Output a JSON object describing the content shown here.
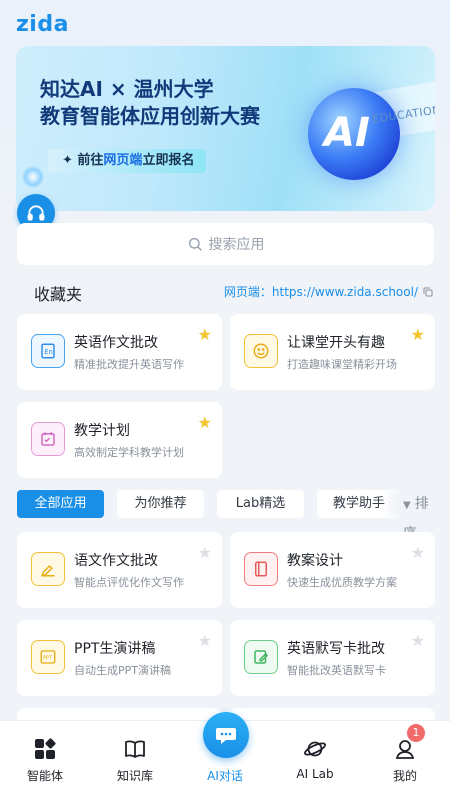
{
  "brand": {
    "logo": "zida",
    "accent": "#1a8fe8"
  },
  "banner": {
    "title_line1": "知达AI × 温州大学",
    "title_line2": "教育智能体应用创新大赛",
    "cta_prefix": "✦ 前往",
    "cta_highlight": "网页端",
    "cta_suffix": "立即报名",
    "orb_text": "AI",
    "side_text": "EDUCATION"
  },
  "search": {
    "placeholder": "搜索应用",
    "icon": "search-icon"
  },
  "favorites": {
    "title": "收藏夹",
    "link_label": "网页端：https://www.zida.school/",
    "items": [
      {
        "title": "英语作文批改",
        "subtitle": "精准批改提升英语写作",
        "icon": "essay-icon",
        "starred": true
      },
      {
        "title": "让课堂开头有趣",
        "subtitle": "打造趣味课堂精彩开场",
        "icon": "smile-icon",
        "starred": true
      },
      {
        "title": "教学计划",
        "subtitle": "高效制定学科教学计划",
        "icon": "calendar-icon",
        "starred": true
      }
    ]
  },
  "tabs": {
    "items": [
      "全部应用",
      "为你推荐",
      "Lab精选",
      "教学助手"
    ],
    "active_index": 0,
    "sort_label": "排序"
  },
  "apps": [
    {
      "title": "语文作文批改",
      "subtitle": "智能点评优化作文写作",
      "icon": "pen-icon",
      "starred": false
    },
    {
      "title": "教案设计",
      "subtitle": "快速生成优质教学方案",
      "icon": "notebook-icon",
      "starred": false
    },
    {
      "title": "PPT生演讲稿",
      "subtitle": "自动生成PPT演讲稿",
      "icon": "ppt-icon",
      "starred": false
    },
    {
      "title": "英语默写卡批改",
      "subtitle": "智能批改英语默写卡",
      "icon": "edit-card-icon",
      "starred": false
    }
  ],
  "bottom_nav": {
    "items": [
      {
        "label": "智能体",
        "icon": "grid-icon"
      },
      {
        "label": "知识库",
        "icon": "book-icon"
      },
      {
        "label": "AI对话",
        "icon": "chat-icon"
      },
      {
        "label": "AI Lab",
        "icon": "planet-icon"
      },
      {
        "label": "我的",
        "icon": "user-icon"
      }
    ],
    "active_index": 2,
    "badge_count": "1"
  }
}
